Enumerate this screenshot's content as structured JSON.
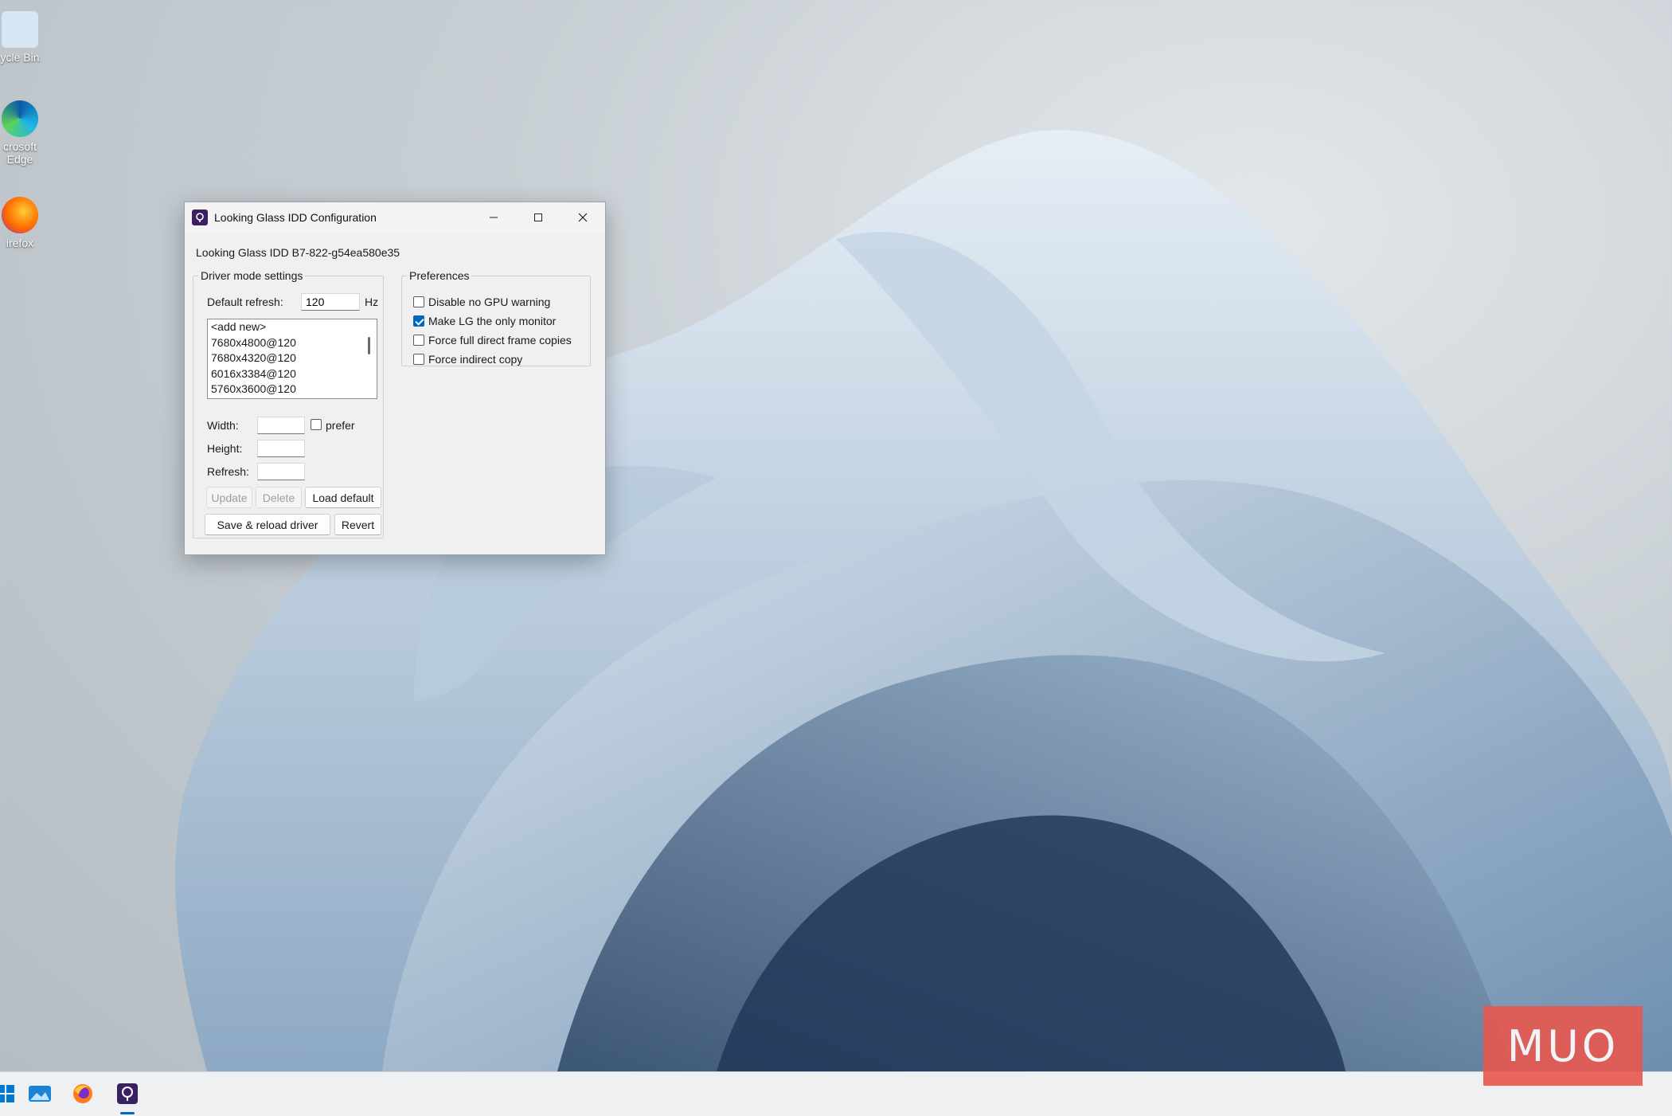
{
  "desktop": {
    "icons": [
      {
        "label": "ycle Bin",
        "icon": "recycle-bin-icon"
      },
      {
        "label": "crosoft\nEdge",
        "icon": "edge-icon"
      },
      {
        "label": "irefox",
        "icon": "firefox-icon"
      }
    ]
  },
  "window": {
    "title": "Looking Glass IDD Configuration",
    "device_line": "Looking Glass IDD B7-822-g54ea580e35",
    "driver_group": {
      "legend": "Driver mode settings",
      "default_refresh_label": "Default refresh:",
      "default_refresh_value": "120",
      "hz_label": "Hz",
      "modes": [
        "<add new>",
        "7680x4800@120",
        "7680x4320@120",
        "6016x3384@120",
        "5760x3600@120"
      ],
      "width_label": "Width:",
      "height_label": "Height:",
      "refresh_label": "Refresh:",
      "prefer_label": "prefer",
      "prefer_checked": false,
      "update_label": "Update",
      "delete_label": "Delete",
      "load_default_label": "Load default",
      "save_reload_label": "Save & reload driver",
      "revert_label": "Revert"
    },
    "prefs_group": {
      "legend": "Preferences",
      "options": [
        {
          "label": "Disable no GPU warning",
          "checked": false
        },
        {
          "label": "Make LG the only monitor",
          "checked": true
        },
        {
          "label": "Force full direct frame copies",
          "checked": false
        },
        {
          "label": "Force indirect copy",
          "checked": false
        }
      ]
    }
  },
  "taskbar": {
    "items": [
      "start-icon",
      "photos-icon",
      "firefox-icon",
      "looking-glass-icon"
    ],
    "active_item": "looking-glass-icon"
  },
  "watermark": {
    "text": "MUO"
  },
  "colors": {
    "accent": "#0067c0",
    "watermark": "#e8584f",
    "app_icon": "#3a1f63"
  }
}
